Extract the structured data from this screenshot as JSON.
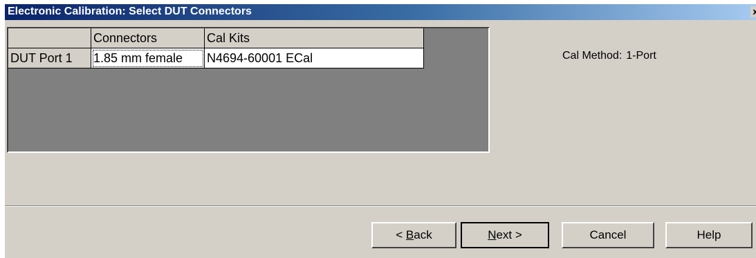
{
  "window": {
    "title": "Electronic Calibration: Select DUT Connectors",
    "close_glyph": "x"
  },
  "grid": {
    "columns": [
      "",
      "Connectors",
      "Cal Kits"
    ],
    "rows": [
      {
        "port": "DUT Port 1",
        "connector": "1.85 mm female",
        "cal_kit": "N4694-60001 ECal"
      }
    ]
  },
  "cal_method": {
    "label": "Cal Method:",
    "value": "1-Port"
  },
  "buttons": {
    "back_prefix": "< ",
    "back_mnemonic": "B",
    "back_rest": "ack",
    "next_mnemonic": "N",
    "next_rest": "ext >",
    "cancel": "Cancel",
    "help": "Help"
  },
  "colors": {
    "dialog_bg": "#d4d0c8",
    "grid_bg": "#808080",
    "title_start": "#0a246a",
    "title_end": "#a6caf0"
  }
}
